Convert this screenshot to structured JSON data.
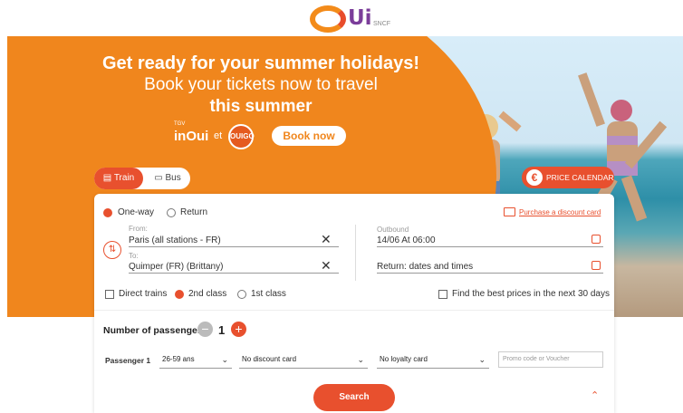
{
  "header": {
    "logo_main": "Ui",
    "logo_sub": "SNCF"
  },
  "banner": {
    "headline": "Get ready for your summer holidays!",
    "subline1": "Book your tickets now to travel",
    "subline2": "this summer",
    "brand_inoui_small": "TGV",
    "brand_inoui": "inOui",
    "brand_et": "et",
    "brand_ouigo": "OUIGO",
    "book_now": "Book now"
  },
  "mode_tabs": {
    "train": "Train",
    "bus": "Bus"
  },
  "price_calendar": {
    "symbol": "€",
    "label": "PRICE CALENDAR"
  },
  "form": {
    "trip_type": {
      "one_way": "One-way",
      "return": "Return",
      "selected": "One-way"
    },
    "discount_link": "Purchase a discount card",
    "from_label": "From:",
    "from_value": "Paris (all stations - FR)",
    "to_label": "To:",
    "to_value": "Quimper (FR) (Brittany)",
    "outbound_label": "Outbound",
    "outbound_value": "14/06 At 06:00",
    "return_placeholder": "Return: dates and times",
    "direct_trains": "Direct trains",
    "class_2": "2nd class",
    "class_1": "1st class",
    "selected_class": "2nd class",
    "best_prices": "Find the best prices in the next 30 days"
  },
  "passengers": {
    "title": "Number of passengers",
    "count": "1",
    "row_label": "Passenger 1",
    "age": "26-59 ans",
    "discount_card": "No discount card",
    "loyalty_card": "No loyalty card",
    "promo_placeholder": "Promo code or Voucher"
  },
  "search": "Search",
  "colors": {
    "orange": "#f0861d",
    "accent": "#e8502e",
    "purple": "#7b3d9a"
  }
}
